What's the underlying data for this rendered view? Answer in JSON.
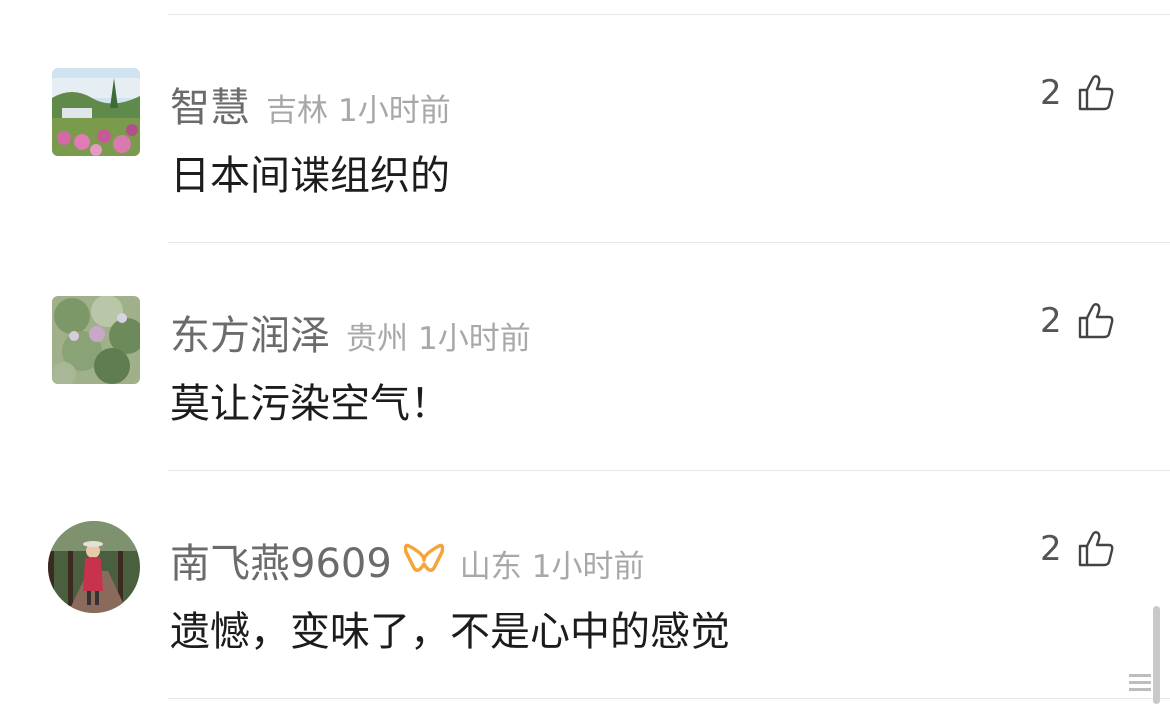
{
  "comments": [
    {
      "username": "智慧",
      "location": "吉林",
      "time": "1小时前",
      "text": "日本间谍组织的",
      "likes": "2",
      "avatar_icon": "landscape-flowers-avatar",
      "has_badge": false
    },
    {
      "username": "东方润泽",
      "location": "贵州",
      "time": "1小时前",
      "text": "莫让污染空气！",
      "likes": "2",
      "avatar_icon": "tree-foliage-avatar",
      "has_badge": false
    },
    {
      "username": "南飞燕9609",
      "location": "山东",
      "time": "1小时前",
      "text": "遗憾，变味了，不是心中的感觉",
      "likes": "2",
      "avatar_icon": "person-on-bridge-avatar",
      "has_badge": true,
      "badge_icon": "member-badge-icon",
      "badge_color": "#f5a43a"
    }
  ],
  "colors": {
    "username": "#6b6b6b",
    "meta": "#a8a8a8",
    "text": "#1c1c1c",
    "divider": "#e8e8e8"
  }
}
